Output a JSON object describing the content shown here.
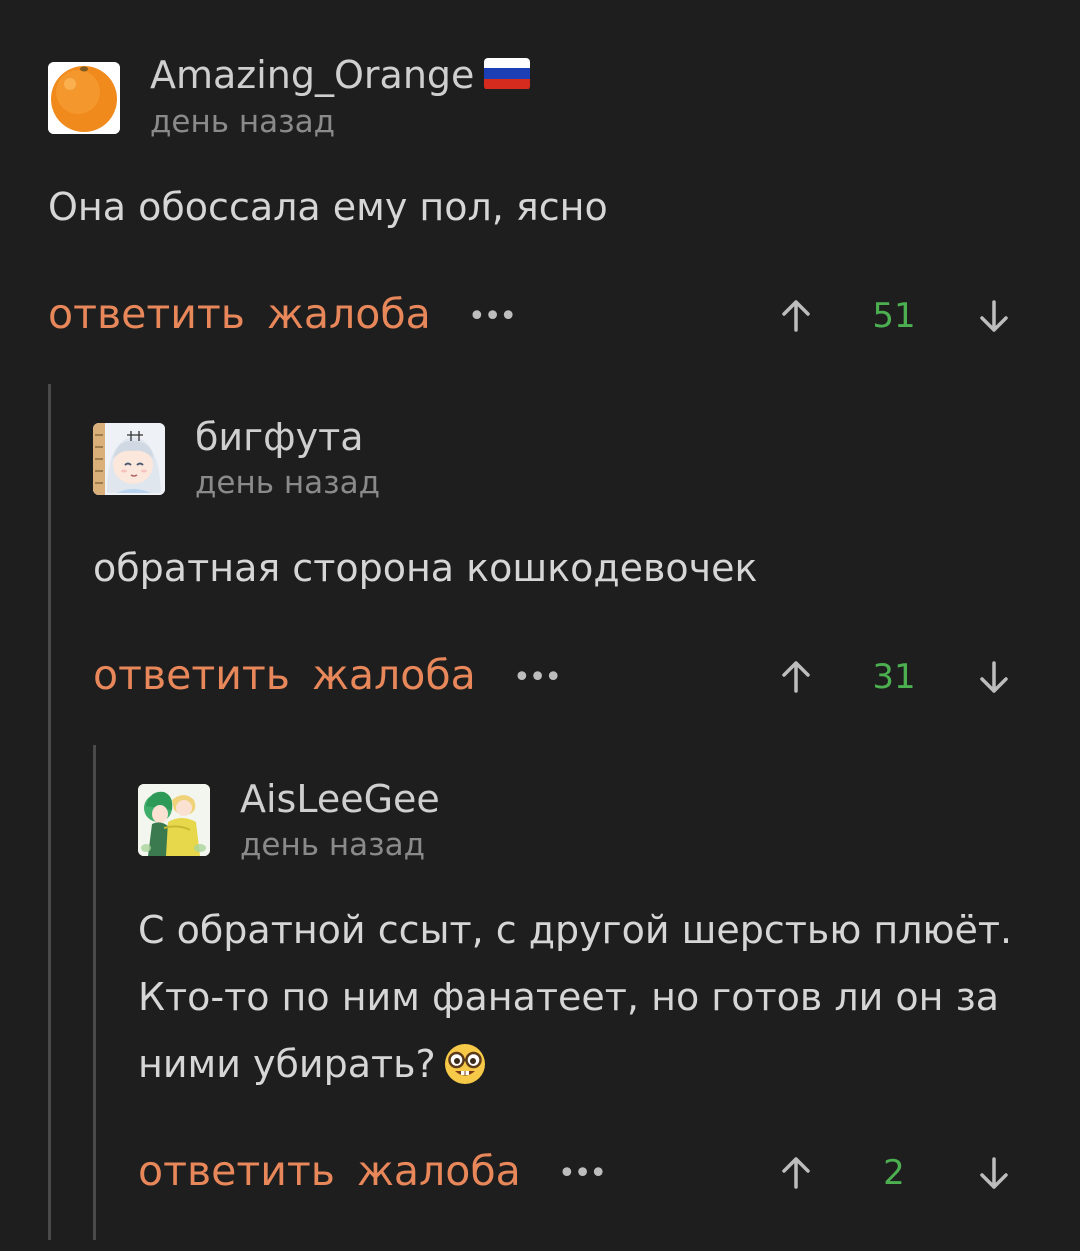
{
  "comments": [
    {
      "username": "Amazing_Orange",
      "flag": "russia-flag",
      "time": "день назад",
      "lines": [
        "Она обоссала ему пол, ясно"
      ],
      "actions": {
        "reply": "ответить",
        "report": "жалоба",
        "more": "•••"
      },
      "rating": "51"
    },
    {
      "username": "бигфута",
      "time": "день назад",
      "lines": [
        "обратная сторона кошкодевочек"
      ],
      "actions": {
        "reply": "ответить",
        "report": "жалоба",
        "more": "•••"
      },
      "rating": "31"
    },
    {
      "username": "AisLeeGee",
      "time": "день назад",
      "lines": [
        "С обратной ссыт, с другой шерстью плюёт.",
        "Кто-то по ним фанатеет, но готов ли он за",
        "ними убирать?"
      ],
      "emoji": "nerd-face-emoji",
      "actions": {
        "reply": "ответить",
        "report": "жалоба",
        "more": "•••"
      },
      "rating": "2"
    }
  ],
  "colors": {
    "background": "#1e1e1e",
    "action": "#e8875a",
    "rating": "#4caf50",
    "username": "#cfcfcf",
    "time": "#8a8a8a",
    "text": "#d6d6d6"
  }
}
